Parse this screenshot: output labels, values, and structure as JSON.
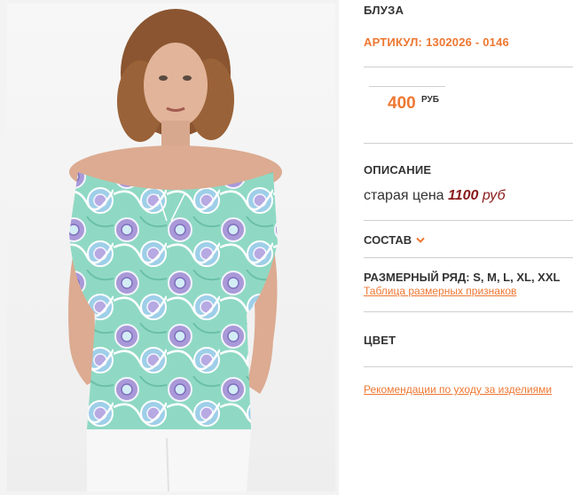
{
  "product": {
    "title": "БЛУЗА",
    "article_label": "АРТИКУЛ:",
    "article_value": "1302026 - 0146",
    "price": "400",
    "currency": "РУБ"
  },
  "description": {
    "heading": "ОПИСАНИЕ",
    "old_price_label": "старая цена",
    "old_price_value": "1100",
    "old_price_unit": "руб"
  },
  "composition": {
    "heading": "СОСТАВ",
    "icon": "chevron-down-icon"
  },
  "sizes": {
    "label": "РАЗМЕРНЫЙ РЯД:",
    "values": "S, M, L, XL, XXL",
    "chart_link": "Таблица размерных признаков"
  },
  "color": {
    "heading": "ЦВЕТ"
  },
  "care": {
    "link": "Рекомендации по уходу за изделиями"
  },
  "colors": {
    "accent": "#ee7731",
    "old_price": "#8a1a1a",
    "text": "#333333",
    "divider": "#cfcfcf"
  }
}
